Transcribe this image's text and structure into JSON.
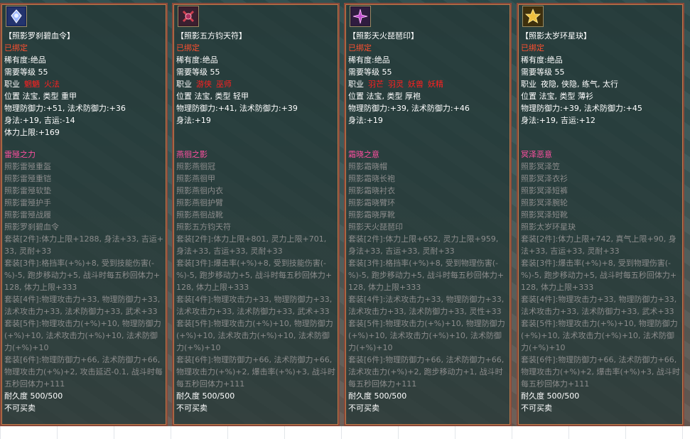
{
  "panels": [
    {
      "icon": "blue-gem-icon",
      "name": "【照影罗刹碧血令】",
      "bound": "已绑定",
      "rarity": "稀有度:绝品",
      "level": "需要等级 55",
      "job_label": "职业",
      "jobs": [
        "魍魉",
        "火法"
      ],
      "slot": "位置 法宝, 类型 重甲",
      "stat1": "物理防御力:+51, 法术防御力:+36",
      "stat2": "身法:+19, 吉运:-14",
      "stat3": "体力上限:+169",
      "set_name": "雷殛之力",
      "set_items": [
        "照影雷殛重盔",
        "照影雷殛重铠",
        "照影雷殛软垫",
        "照影雷殛护手",
        "照影雷殛战履",
        "照影罗刹碧血令"
      ],
      "bonuses": [
        "套装[2件]:体力上限+1288, 身法+33, 吉运+33, 灵耐+33",
        "套装[3件]:格挡率(+%)+8, 受到技能伤害(-%)-5, 跑步移动力+5, 战斗时每五秒回体力+128, 体力上限+333",
        "套装[4件]:物理攻击力+33, 物理防御力+33, 法术攻击力+33, 法术防御力+33, 武术+33",
        "套装[5件]:物理攻击力(+%)+10, 物理防御力(+%)+10, 法术攻击力(+%)+10, 法术防御力(+%)+10",
        "套装[6件]:物理防御力+66, 法术防御力+66, 物理攻击力(+%)+2, 攻击延迟-0.1, 战斗时每五秒回体力+111"
      ],
      "durability": "耐久度 500/500",
      "trade": "不可买卖"
    },
    {
      "icon": "red-talisman-icon",
      "name": "【照影五方钧天符】",
      "bound": "已绑定",
      "rarity": "稀有度:绝品",
      "level": "需要等级 55",
      "job_label": "职业",
      "jobs": [
        "游侠",
        "巫师"
      ],
      "slot": "位置 法宝, 类型 轻甲",
      "stat1": "物理防御力:+41, 法术防御力:+39",
      "stat2": "身法:+19",
      "stat3": "",
      "set_name": "燕徊之影",
      "set_items": [
        "照影燕徊冠",
        "照影燕徊甲",
        "照影燕徊内衣",
        "照影燕徊护臂",
        "照影燕徊战靴",
        "照影五方钧天符"
      ],
      "bonuses": [
        "套装[2件]:体力上限+801, 灵力上限+701, 身法+33, 吉运+33, 灵耐+33",
        "套装[3件]:爆击率(+%)+8, 受到技能伤害(-%)-5, 跑步移动力+5, 战斗时每五秒回体力+128, 体力上限+333",
        "套装[4件]:物理攻击力+33, 物理防御力+33, 法术攻击力+33, 法术防御力+33, 武术+33",
        "套装[5件]:物理攻击力(+%)+10, 物理防御力(+%)+10, 法术攻击力(+%)+10, 法术防御力(+%)+10",
        "套装[6件]:物理防御力+66, 法术防御力+66, 物理攻击力(+%)+2, 爆击率(+%)+3, 战斗时每五秒回体力+111"
      ],
      "durability": "耐久度 500/500",
      "trade": "不可买卖"
    },
    {
      "icon": "purple-seal-icon",
      "name": "【照影天火琵琶印】",
      "bound": "已绑定",
      "rarity": "稀有度:绝品",
      "level": "需要等级 55",
      "job_label": "职业",
      "jobs": [
        "羽芒",
        "羽灵",
        "妖兽",
        "妖精"
      ],
      "slot": "位置 法宝, 类型 厚袍",
      "stat1": "物理防御力:+39, 法术防御力:+46",
      "stat2": "身法:+19",
      "stat3": "",
      "set_name": "霜晓之意",
      "set_items": [
        "照影霜晓帽",
        "照影霜晓长袍",
        "照影霜晓衬衣",
        "照影霜晓臂环",
        "照影霜晓厚靴",
        "照影天火琵琶印"
      ],
      "bonuses": [
        "套装[2件]:体力上限+652, 灵力上限+959, 身法+33, 吉运+33, 灵耐+33",
        "套装[3件]:格挡率(+%)+8, 受到物理伤害(-%)-5, 跑步移动力+5, 战斗时每五秒回体力+128, 体力上限+333",
        "套装[4件]:法术攻击力+33, 物理防御力+33, 法术攻击力+33, 法术防御力+33, 灵性+33",
        "套装[5件]:物理攻击力(+%)+10, 物理防御力(+%)+10, 法术攻击力(+%)+10, 法术防御力(+%)+10",
        "套装[6件]:物理防御力+66, 法术防御力+66, 法术攻击力(+%)+2, 跑步移动力+1, 战斗时每五秒回体力+111"
      ],
      "durability": "耐久度 500/500",
      "trade": "不可买卖"
    },
    {
      "icon": "gold-star-icon",
      "name": "【照影太岁环星玦】",
      "bound": "已绑定",
      "rarity": "稀有度:绝品",
      "level": "需要等级 55",
      "job_label": "职业",
      "jobs": [
        "夜隐, 侠隐, 练气, 太行"
      ],
      "jobs_color": "#ffffff",
      "slot": "位置 法宝, 类型 薄衫",
      "stat1": "物理防御力:+39, 法术防御力:+45",
      "stat2": "身法:+19, 吉运:+12",
      "stat3": "",
      "set_name": "冥泽恶意",
      "set_items": [
        "照影冥泽笠",
        "照影冥泽衣衫",
        "照影冥泽短裤",
        "照影冥泽腕轮",
        "照影冥泽短靴",
        "照影太岁环星玦"
      ],
      "bonuses": [
        "套装[2件]:体力上限+742, 真气上限+90, 身法+33, 吉运+33, 灵耐+33",
        "套装[3件]:爆击率(+%)+8, 受到物理伤害(-%)-5, 跑步移动力+5, 战斗时每五秒回体力+128, 体力上限+333",
        "套装[4件]:物理攻击力+33, 物理防御力+33, 法术攻击力+33, 法术防御力+33, 武术+33",
        "套装[5件]:物理攻击力(+%)+10, 物理防御力(+%)+10, 法术攻击力(+%)+10, 法术防御力(+%)+10",
        "套装[6件]:物理防御力+66, 法术防御力+66, 物理攻击力(+%)+2, 爆击率(+%)+3, 战斗时每五秒回体力+111"
      ],
      "durability": "耐久度 500/500",
      "trade": "不可买卖"
    }
  ],
  "colors": {
    "bound": "#ff5030",
    "set_name": "#ff4fa0",
    "job_highlight": "#ff2020",
    "inactive_text": "#8c8c8c",
    "panel_border": "#8a4a3a"
  }
}
